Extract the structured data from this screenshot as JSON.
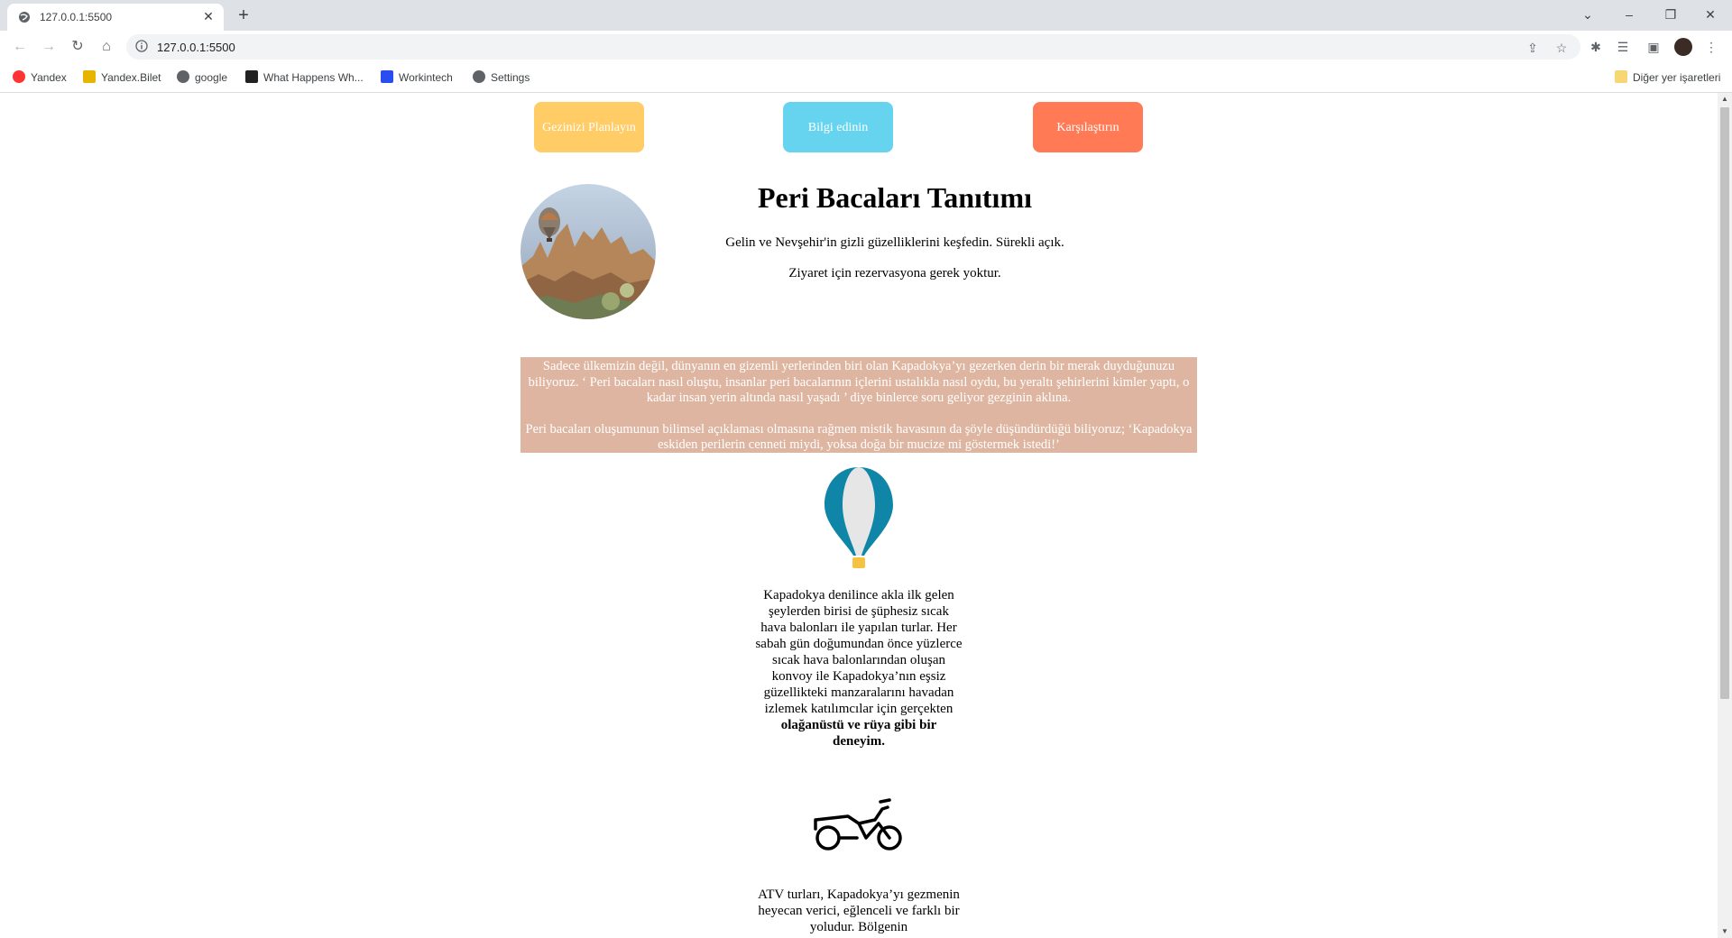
{
  "browser": {
    "tab_title": "127.0.0.1:5500",
    "url": "127.0.0.1:5500",
    "bookmarks": [
      {
        "label": "Yandex",
        "icon": "yandex-icon"
      },
      {
        "label": "Yandex.Bilet",
        "icon": "plane-icon"
      },
      {
        "label": "google",
        "icon": "globe-icon"
      },
      {
        "label": "What Happens Wh...",
        "icon": "grid-icon"
      },
      {
        "label": "Workintech",
        "icon": "workintech-icon"
      },
      {
        "label": "Settings",
        "icon": "gear-icon"
      }
    ],
    "other_bookmarks": "Diğer yer işaretleri"
  },
  "page": {
    "buttons": [
      {
        "label": "Gezinizi Planlayın",
        "color": "#ffcc66"
      },
      {
        "label": "Bilgi edinin",
        "color": "#66d4ee"
      },
      {
        "label": "Karşılaştırın",
        "color": "#ff7a55"
      }
    ],
    "title": "Peri Bacaları Tanıtımı",
    "intro": [
      "Gelin ve Nevşehir'in gizli güzelliklerini keşfedin. Sürekli açık.",
      "Ziyaret için rezervasyona gerek yoktur."
    ],
    "info_paragraphs": [
      "Sadece ülkemizin değil, dünyanın en gizemli yerlerinden biri olan Kapadokya’yı gezerken derin bir merak duyduğunuzu biliyoruz. ‘ Peri bacaları nasıl oluştu, insanlar peri bacalarının içlerini ustalıkla nasıl oydu, bu yeraltı şehirlerini kimler yaptı, o kadar insan yerin altında nasıl yaşadı ’ diye binlerce soru geliyor gezginin aklına.",
      "Peri bacaları oluşumunun bilimsel açıklaması olmasına rağmen mistik havasının da şöyle düşündürdüğü biliyoruz; ‘Kapadokya eskiden perilerin cenneti miydi, yoksa doğa bir mucize mi göstermek istedi!’"
    ],
    "info_box_color": "#deb5a0",
    "balloon_text": "Kapadokya denilince akla ilk gelen şeylerden birisi de şüphesiz sıcak hava balonları ile yapılan turlar. Her sabah gün doğumundan önce yüzlerce sıcak hava balonlarından oluşan konvoy ile Kapadokya’nın eşsiz güzellikteki manzaralarını havadan izlemek katılımcılar için gerçekten",
    "balloon_text_bold": "olağanüstü ve rüya gibi bir deneyim.",
    "atv_text": "ATV turları, Kapadokya’yı gezmenin heyecan verici, eğlenceli ve farklı bir yoludur. Bölgenin"
  }
}
